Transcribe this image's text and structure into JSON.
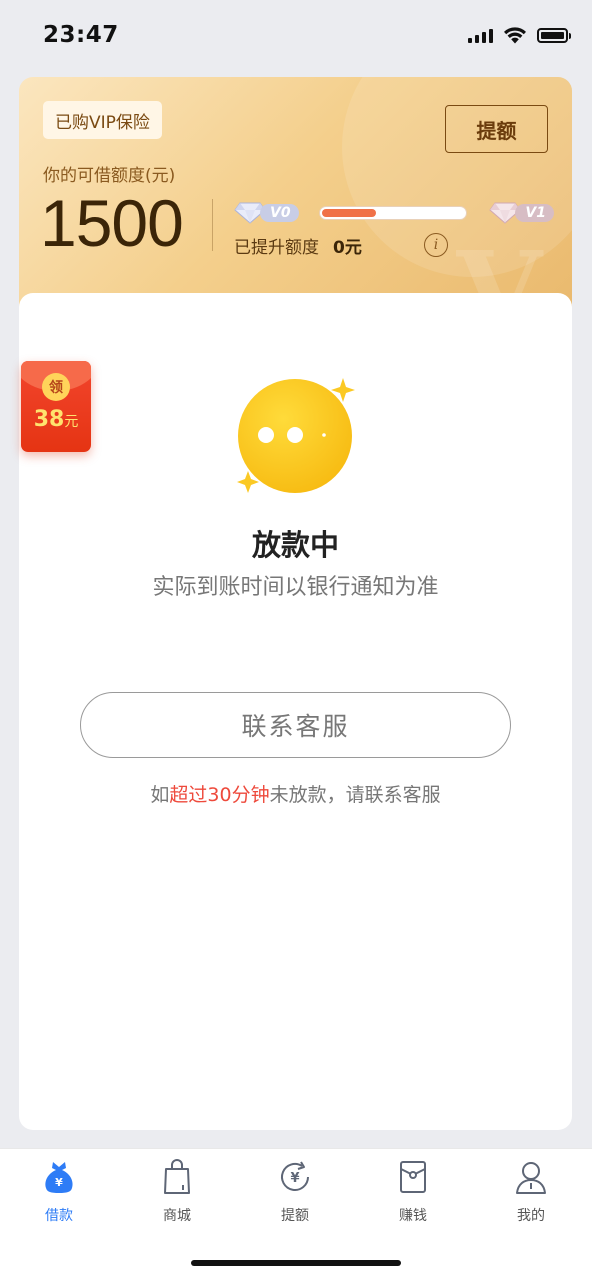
{
  "status_bar": {
    "time": "23:47"
  },
  "card": {
    "vip_badge": "已购VIP保险",
    "raise_button": "提额",
    "limit_label": "你的可借额度(元)",
    "limit_value": "1500",
    "level_current": "V0",
    "level_next": "V1",
    "level_progress": 0.38,
    "raised_label": "已提升额度",
    "raised_value": "0元"
  },
  "red_envelope": {
    "coin_label": "领",
    "amount": "38",
    "unit": "元"
  },
  "state": {
    "title": "放款中",
    "subtitle": "实际到账时间以银行通知为准",
    "contact_button": "联系客服",
    "notice_prefix": "如",
    "notice_highlight": "超过30分钟",
    "notice_suffix": "未放款，请联系客服"
  },
  "colors": {
    "accent": "#2e7cf6",
    "highlight": "#ee4a3c",
    "progress": "#f07148"
  },
  "tabs": [
    {
      "label": "借款",
      "icon": "money-bag-icon",
      "active": true
    },
    {
      "label": "商城",
      "icon": "shopping-bag-icon",
      "active": false
    },
    {
      "label": "提额",
      "icon": "yuan-refresh-icon",
      "active": false
    },
    {
      "label": "赚钱",
      "icon": "envelope-icon",
      "active": false
    },
    {
      "label": "我的",
      "icon": "user-icon",
      "active": false
    }
  ]
}
